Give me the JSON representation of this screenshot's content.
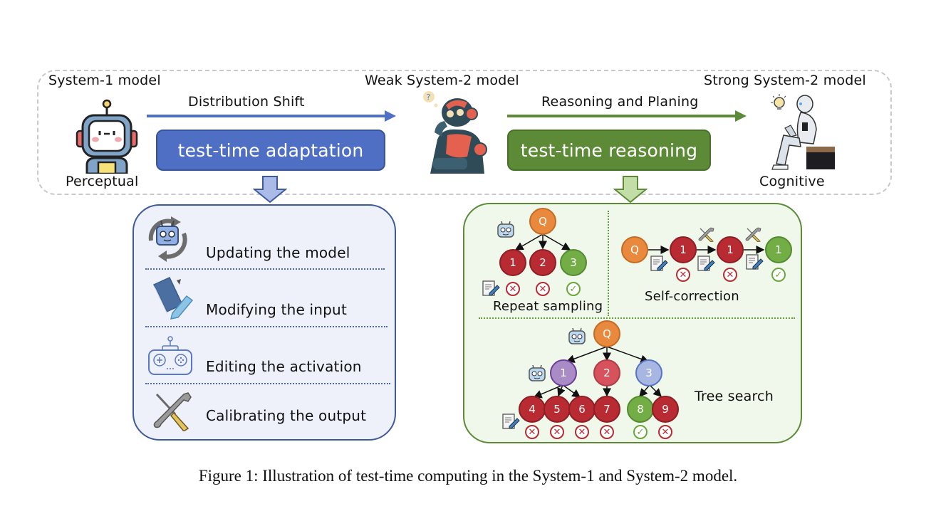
{
  "stages": [
    {
      "title": "System-1 model",
      "label": "Perceptual",
      "icon": "cute-robot-icon"
    },
    {
      "title": "Weak System-2 model",
      "icon": "thinking-robot-icon"
    },
    {
      "title": "Strong System-2 model",
      "label": "Cognitive",
      "icon": "sitting-robot-icon"
    }
  ],
  "transitions": [
    {
      "label": "Distribution Shift",
      "method": "test-time adaptation",
      "color": "#4f6fc4"
    },
    {
      "label": "Reasoning and Planing",
      "method": "test-time reasoning",
      "color": "#5c8a37"
    }
  ],
  "adaptation_panel": {
    "items": [
      {
        "label": "Updating the model",
        "icon": "robot-cycle-icon"
      },
      {
        "label": "Modifying the input",
        "icon": "book-pen-icon"
      },
      {
        "label": "Editing the activation",
        "icon": "gamepad-icon"
      },
      {
        "label": "Calibrating the output",
        "icon": "tools-icon"
      }
    ]
  },
  "reasoning_panel": {
    "repeat_sampling": {
      "label": "Repeat sampling",
      "root": "Q",
      "children": [
        {
          "label": "1",
          "result": "wrong"
        },
        {
          "label": "2",
          "result": "wrong"
        },
        {
          "label": "3",
          "result": "correct"
        }
      ]
    },
    "self_correction": {
      "label": "Self-correction",
      "chain": [
        {
          "label": "Q",
          "result": "none"
        },
        {
          "label": "1",
          "result": "wrong"
        },
        {
          "label": "1",
          "result": "wrong"
        },
        {
          "label": "1",
          "result": "correct"
        }
      ]
    },
    "tree_search": {
      "label": "Tree search",
      "root": "Q",
      "level1": [
        "1",
        "2",
        "3"
      ],
      "leaves": [
        {
          "label": "4",
          "result": "wrong"
        },
        {
          "label": "5",
          "result": "wrong"
        },
        {
          "label": "6",
          "result": "wrong"
        },
        {
          "label": "7",
          "result": "wrong"
        },
        {
          "label": "8",
          "result": "correct"
        },
        {
          "label": "9",
          "result": "wrong"
        }
      ]
    },
    "marks": {
      "wrong": "✕",
      "correct": "✓"
    }
  },
  "caption": "Figure 1: Illustration of test-time computing in the System-1 and System-2 model."
}
